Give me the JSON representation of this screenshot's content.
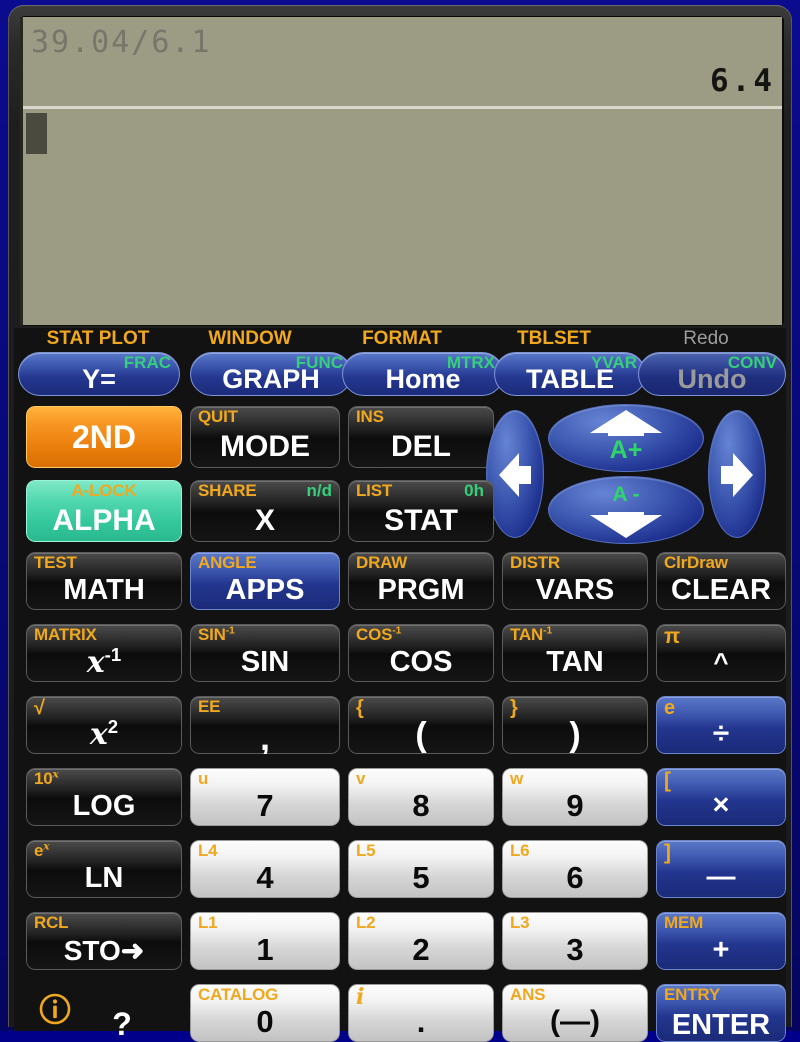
{
  "device": {
    "name": "graphing-calculator",
    "bezel_color": "#1e1e1e",
    "frame_color": "#05055f"
  },
  "lcd": {
    "screen_color": "#9c9c85",
    "expression": "39.04/6.1",
    "result": "6.4",
    "cursor": "block"
  },
  "function_row": {
    "labels": [
      "STAT PLOT",
      "WINDOW",
      "FORMAT",
      "TBLSET",
      "Redo"
    ],
    "keys": [
      {
        "main": "Y=",
        "secondary": "FRAC",
        "disabled": false
      },
      {
        "main": "GRAPH",
        "secondary": "FUNC",
        "disabled": false
      },
      {
        "main": "Home",
        "secondary": "MTRX",
        "disabled": false
      },
      {
        "main": "TABLE",
        "secondary": "YVAR",
        "disabled": false
      },
      {
        "main": "Undo",
        "secondary": "CONV",
        "disabled": true
      }
    ]
  },
  "dpad": {
    "left": "left-arrow",
    "right": "right-arrow",
    "up": "up-arrow",
    "down": "down-arrow",
    "up_label": "A+",
    "down_label": "A -"
  },
  "keys": {
    "second": {
      "main": "2ND",
      "secondary": ""
    },
    "alpha": {
      "main": "ALPHA",
      "secondary": "A-LOCK"
    },
    "mode": {
      "main": "MODE",
      "secondary": "QUIT"
    },
    "del": {
      "main": "DEL",
      "secondary": "INS"
    },
    "x": {
      "main": "X",
      "secondary": "SHARE",
      "secondary_b": "n/d"
    },
    "stat": {
      "main": "STAT",
      "secondary": "LIST",
      "secondary_b": "0h"
    },
    "math": {
      "main": "MATH",
      "secondary": "TEST"
    },
    "apps": {
      "main": "APPS",
      "secondary": "ANGLE"
    },
    "prgm": {
      "main": "PRGM",
      "secondary": "DRAW"
    },
    "vars": {
      "main": "VARS",
      "secondary": "DISTR"
    },
    "clear": {
      "main": "CLEAR",
      "secondary": "ClrDraw"
    },
    "xinv": {
      "main": "x-1",
      "secondary": "MATRIX"
    },
    "sin": {
      "main": "SIN",
      "secondary": "SIN-1"
    },
    "cos": {
      "main": "COS",
      "secondary": "COS-1"
    },
    "tan": {
      "main": "TAN",
      "secondary": "TAN-1"
    },
    "power": {
      "main": "^",
      "secondary": "π"
    },
    "xsq": {
      "main": "x2",
      "secondary": "√"
    },
    "comma": {
      "main": ",",
      "secondary": "EE"
    },
    "lparen": {
      "main": "(",
      "secondary": "{"
    },
    "rparen": {
      "main": ")",
      "secondary": "}"
    },
    "divide": {
      "main": "÷",
      "secondary": "e"
    },
    "log": {
      "main": "LOG",
      "secondary": "10x"
    },
    "seven": {
      "main": "7",
      "secondary": "u"
    },
    "eight": {
      "main": "8",
      "secondary": "v"
    },
    "nine": {
      "main": "9",
      "secondary": "w"
    },
    "multiply": {
      "main": "×",
      "secondary": "["
    },
    "ln": {
      "main": "LN",
      "secondary": "ex"
    },
    "four": {
      "main": "4",
      "secondary": "L4"
    },
    "five": {
      "main": "5",
      "secondary": "L5"
    },
    "six": {
      "main": "6",
      "secondary": "L6"
    },
    "minus": {
      "main": "—",
      "secondary": "]"
    },
    "sto": {
      "main": "STO➜",
      "secondary": "RCL"
    },
    "one": {
      "main": "1",
      "secondary": "L1"
    },
    "two": {
      "main": "2",
      "secondary": "L2"
    },
    "three": {
      "main": "3",
      "secondary": "L3"
    },
    "plus": {
      "main": "+",
      "secondary": "MEM"
    },
    "info": {
      "main": "?",
      "secondary": "i-circle"
    },
    "zero": {
      "main": "0",
      "secondary": "CATALOG"
    },
    "dot": {
      "main": ".",
      "secondary": "i"
    },
    "negate": {
      "main": "(—)",
      "secondary": "ANS"
    },
    "enter": {
      "main": "ENTER",
      "secondary": "ENTRY"
    }
  },
  "colors": {
    "secondary_label": "#f0a81e",
    "alpha_label": "#34d07a",
    "second_key": "#f79421",
    "alpha_key": "#4fd6ad",
    "operator_key": "#24378f",
    "number_key": "#e8e8e8",
    "dark_key": "#151515"
  }
}
